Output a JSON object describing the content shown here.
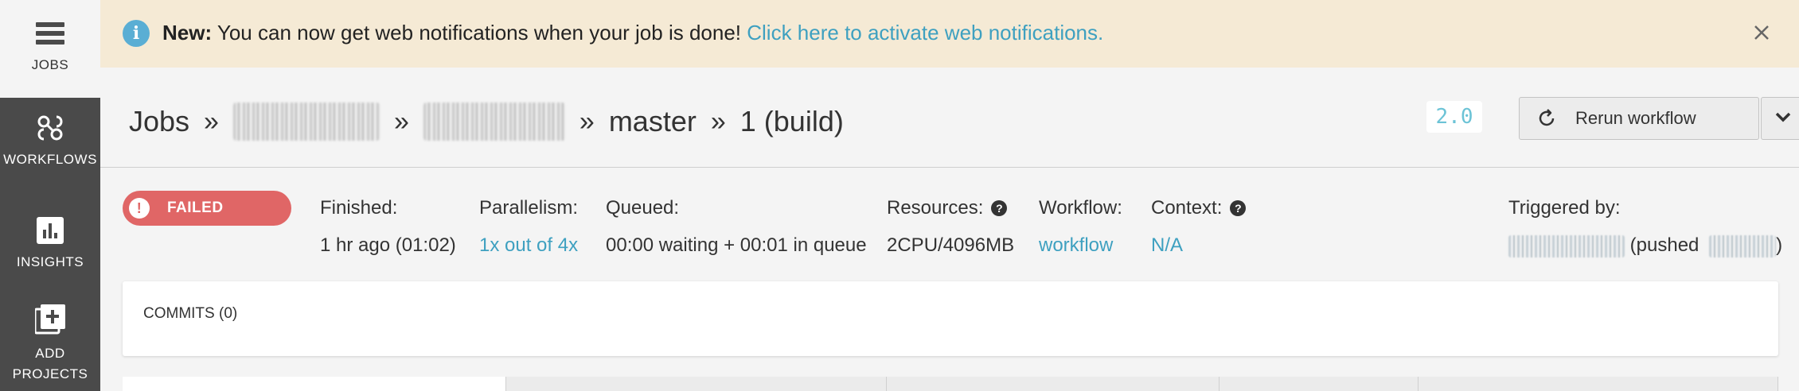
{
  "sidebar": {
    "items": [
      {
        "label": "JOBS",
        "icon": "list-icon"
      },
      {
        "label": "WORKFLOWS",
        "icon": "workflow-icon"
      },
      {
        "label": "INSIGHTS",
        "icon": "bar-chart-icon"
      },
      {
        "label_line1": "ADD",
        "label_line2": "PROJECTS",
        "icon": "add-icon"
      }
    ]
  },
  "banner": {
    "bold": "New:",
    "message": " You can now get web notifications when your job is done! ",
    "link": "Click here to activate web notifications."
  },
  "header": {
    "crumbs": [
      "Jobs",
      "master",
      "1 (build)"
    ],
    "separator": "»",
    "version": "2.0",
    "rerun_label": "Rerun workflow"
  },
  "status": {
    "label": "FAILED",
    "color": "#e06666"
  },
  "meta": {
    "finished_label": "Finished:",
    "finished_value": "1 hr ago (01:02)",
    "parallelism_label": "Parallelism:",
    "parallelism_value": "1x out of 4x",
    "queued_label": "Queued:",
    "queued_value": "00:00 waiting + 00:01 in queue",
    "resources_label": "Resources:",
    "resources_value": "2CPU/4096MB",
    "workflow_label": "Workflow:",
    "workflow_value": "workflow",
    "context_label": "Context:",
    "context_value": "N/A",
    "triggered_label": "Triggered by:",
    "triggered_pushed": "(pushed",
    "triggered_close": ")"
  },
  "commits": {
    "label": "COMMITS (0)"
  },
  "colors": {
    "link": "#3ea0c0",
    "banner_bg": "#f5ead5",
    "sidebar_bg": "#4a4a4a"
  }
}
